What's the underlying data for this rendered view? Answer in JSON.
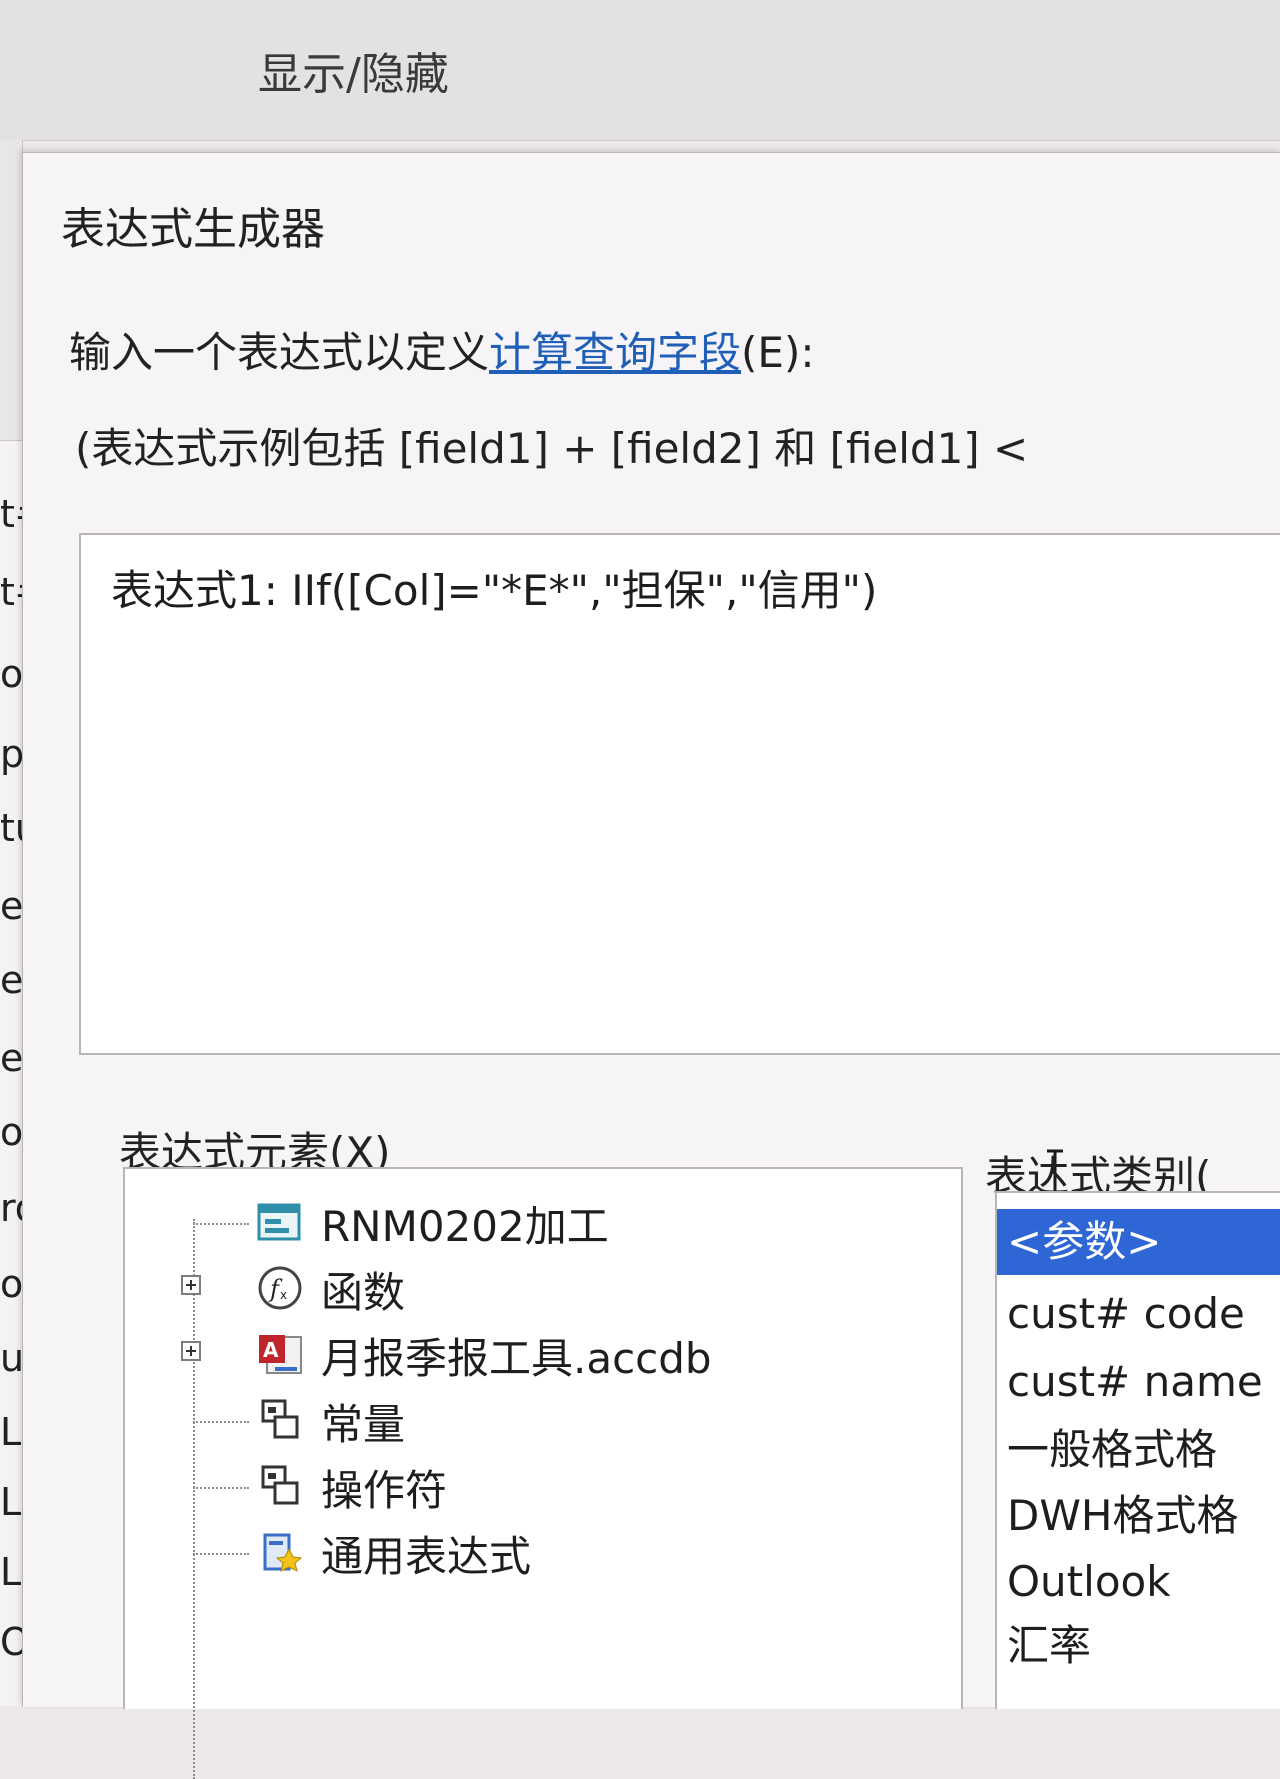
{
  "ribbon": {
    "show_hide_label": "显示/隐藏"
  },
  "left_column": {
    "fragments": [
      "t#",
      "t#",
      "ol",
      "pl",
      "tus",
      "elin",
      "edit",
      "edit",
      "ollat",
      "roup",
      "omn",
      "ulti",
      "LN",
      "LN te",
      "LN te",
      "OD"
    ]
  },
  "dialog": {
    "title": "表达式生成器",
    "prompt": {
      "before": "输入一个表达式以定义",
      "link": "计算查询字段",
      "after": "(E):"
    },
    "example_hint": "(表达式示例包括 [field1] + [field2] 和 [field1] <",
    "expression_value": "表达式1: IIf([Col]=\"*E*\",\"担保\",\"信用\")",
    "elements_label": "表达式元素(X)",
    "categories_label": "表达式类别(",
    "elements": [
      {
        "label": "RNM0202加工",
        "icon": "form-icon",
        "expandable": false
      },
      {
        "label": "函数",
        "icon": "function-icon",
        "expandable": true
      },
      {
        "label": "月报季报工具.accdb",
        "icon": "access-database-icon",
        "expandable": true
      },
      {
        "label": "常量",
        "icon": "constants-icon",
        "expandable": false
      },
      {
        "label": "操作符",
        "icon": "operators-icon",
        "expandable": false
      },
      {
        "label": "通用表达式",
        "icon": "common-expressions-icon",
        "expandable": false
      }
    ],
    "categories": [
      {
        "label": "<参数>",
        "selected": true
      },
      {
        "label": "cust# code",
        "selected": false
      },
      {
        "label": "cust# name",
        "selected": false
      },
      {
        "label": "一般格式格",
        "selected": false
      },
      {
        "label": "DWH格式格",
        "selected": false
      },
      {
        "label": "Outlook",
        "selected": false
      },
      {
        "label": "汇率",
        "selected": false
      }
    ]
  },
  "colors": {
    "link": "#1f5fb8",
    "selection": "#2f66d6"
  }
}
